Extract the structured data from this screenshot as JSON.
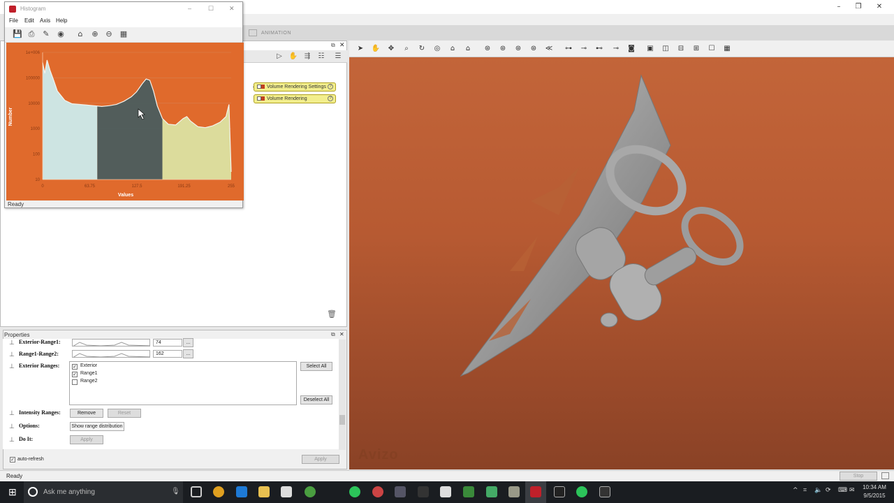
{
  "histogram_window": {
    "title": "Histogram",
    "menu": [
      "File",
      "Edit",
      "Axis",
      "Help"
    ],
    "status": "Ready",
    "plot": {
      "ylabel": "Number",
      "xlabel": "Values",
      "yticks": [
        "1e+006",
        "100000",
        "10000",
        "1000",
        "100",
        "10"
      ],
      "xticks": [
        "0",
        "63.75",
        "127.5",
        "191.25",
        "255"
      ]
    }
  },
  "app": {
    "tab_animation": "ANIMATION",
    "watermark": "Avizo",
    "status": "Ready",
    "stop_label": "Stop"
  },
  "pool": {
    "modules": [
      "Volume Rendering Settings",
      "Volume Rendering"
    ]
  },
  "properties": {
    "title": "Properties",
    "exterior_range1_label": "Exterior-Range1:",
    "exterior_range1_value": "74",
    "range1_range2_label": "Range1-Range2:",
    "range1_range2_value": "162",
    "exterior_ranges_label": "Exterior Ranges:",
    "ranges": [
      {
        "label": "Exterior",
        "checked": true
      },
      {
        "label": "Range1",
        "checked": true
      },
      {
        "label": "Range2",
        "checked": false
      }
    ],
    "select_all": "Select All",
    "deselect_all": "Deselect All",
    "intensity_ranges_label": "Intensity Ranges:",
    "remove": "Remove",
    "reset": "Reset",
    "options_label": "Options:",
    "show_range_distribution": "Show range distribution",
    "do_it_label": "Do It:",
    "apply_small": "Apply",
    "auto_refresh": "auto-refresh",
    "apply": "Apply",
    "ellipsis": "..."
  },
  "taskbar": {
    "search_placeholder": "Ask me anything",
    "time": "10:34 AM",
    "date": "9/5/2015"
  },
  "chart_data": {
    "type": "area",
    "xlabel": "Values",
    "ylabel": "Number",
    "xlim": [
      0,
      255
    ],
    "ylim": [
      10,
      1000000
    ],
    "yscale": "log",
    "x": [
      0,
      3,
      6,
      10,
      15,
      20,
      30,
      40,
      50,
      60,
      70,
      74,
      80,
      90,
      100,
      110,
      120,
      127,
      135,
      140,
      145,
      150,
      155,
      162,
      170,
      180,
      190,
      195,
      200,
      210,
      220,
      230,
      240,
      248,
      252,
      255
    ],
    "y": [
      400000,
      150000,
      500000,
      200000,
      80000,
      30000,
      13000,
      9500,
      9000,
      8500,
      8000,
      7800,
      7500,
      8000,
      9000,
      12000,
      18000,
      28000,
      60000,
      90000,
      80000,
      30000,
      8000,
      2500,
      1500,
      1400,
      2500,
      3000,
      2000,
      1200,
      1100,
      1300,
      1800,
      3000,
      9000,
      20
    ],
    "ranges": [
      {
        "name": "Exterior",
        "from": 0,
        "to": 74
      },
      {
        "name": "Range1",
        "from": 74,
        "to": 162
      },
      {
        "name": "Range2",
        "from": 162,
        "to": 255
      }
    ]
  }
}
